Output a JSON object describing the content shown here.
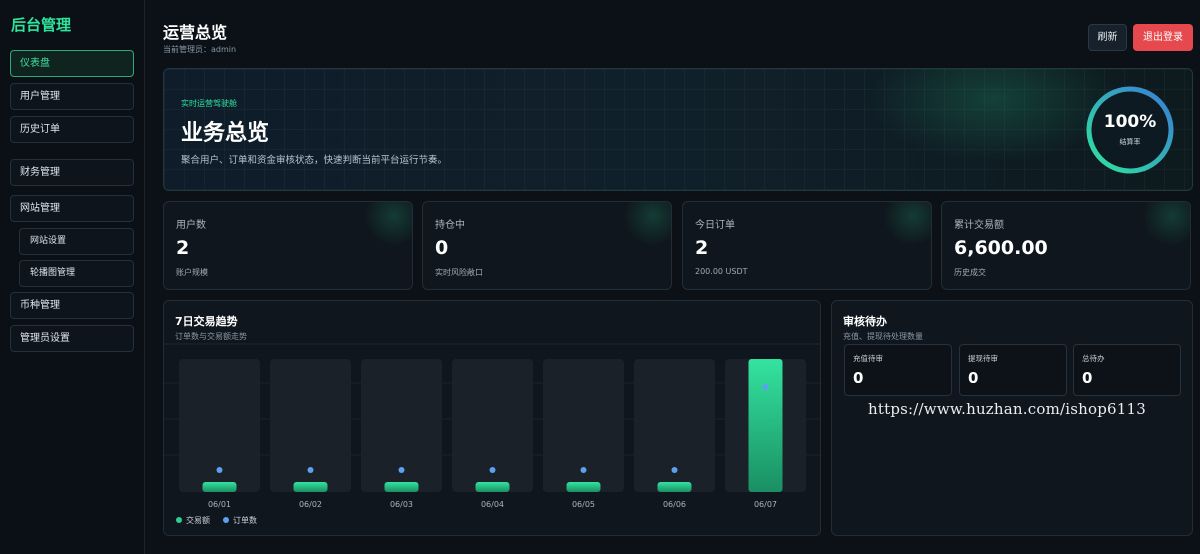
{
  "sidebar": {
    "brand": "后台管理",
    "items": [
      {
        "label": "仪表盘"
      },
      {
        "label": "用户管理"
      },
      {
        "label": "历史订单"
      },
      {
        "label": "财务管理"
      },
      {
        "label": "网站管理"
      },
      {
        "label": "网站设置"
      },
      {
        "label": "轮播图管理"
      },
      {
        "label": "币种管理"
      },
      {
        "label": "管理员设置"
      }
    ]
  },
  "header": {
    "title": "运营总览",
    "subtitle": "当前管理员：admin",
    "refresh_label": "刷新",
    "logout_label": "退出登录"
  },
  "hero": {
    "tag": "实时运营驾驶舱",
    "title": "业务总览",
    "description": "聚合用户、订单和资金审核状态，快速判断当前平台运行节奏。",
    "gauge_value": "100%",
    "gauge_fraction": 1.0,
    "gauge_label": "结算率"
  },
  "stats": [
    {
      "label": "用户数",
      "value": "2",
      "sub": "账户规模"
    },
    {
      "label": "持仓中",
      "value": "0",
      "sub": "实时风险敞口"
    },
    {
      "label": "今日订单",
      "value": "2",
      "sub": "200.00 USDT"
    },
    {
      "label": "累计交易额",
      "value": "6,600.00",
      "sub": "历史成交"
    }
  ],
  "chart_panel": {
    "title": "7日交易趋势",
    "subtitle": "订单数与交易额走势"
  },
  "chart_data": {
    "type": "bar",
    "categories": [
      "06/01",
      "06/02",
      "06/03",
      "06/04",
      "06/05",
      "06/06",
      "06/07"
    ],
    "series": [
      {
        "name": "交易额",
        "type": "bar",
        "values": [
          0,
          0,
          0,
          0,
          0,
          0,
          6600
        ]
      },
      {
        "name": "订单数",
        "type": "point",
        "values": [
          0,
          0,
          0,
          0,
          0,
          0,
          2
        ]
      }
    ],
    "legend_position": "bottom-left",
    "colors": {
      "bar": "#2ecc8f",
      "point": "#5aa2f0"
    }
  },
  "review": {
    "title": "审核待办",
    "subtitle": "充值、提现待处理数量",
    "cards": [
      {
        "label": "充值待审",
        "value": "0"
      },
      {
        "label": "提现待审",
        "value": "0"
      },
      {
        "label": "总待办",
        "value": "0"
      }
    ]
  },
  "watermark": "https://www.huzhan.com/ishop6113",
  "colors": {
    "accent": "#2ee59d",
    "danger": "#e5484d",
    "background": "#0b1117"
  }
}
